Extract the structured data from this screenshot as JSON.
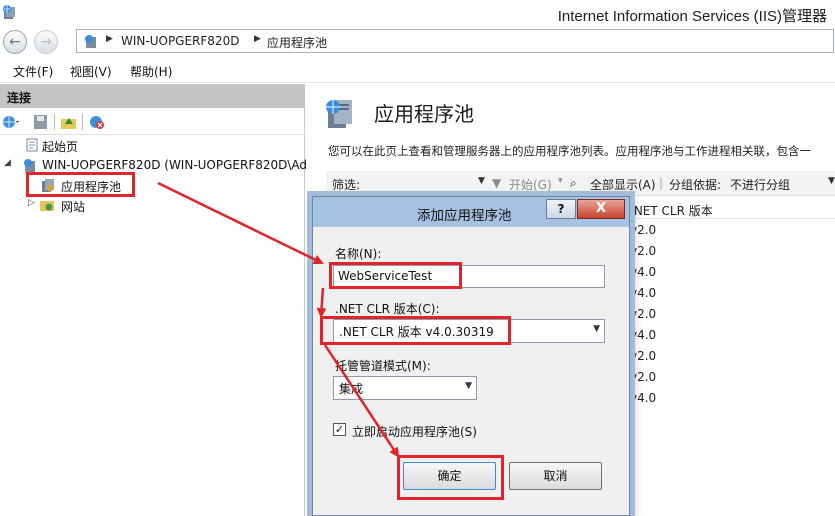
{
  "window": {
    "title": "Internet Information Services (IIS)管理器"
  },
  "address": {
    "segments": [
      "WIN-UOPGERF820D",
      "应用程序池"
    ]
  },
  "menu": {
    "items": [
      "文件(F)",
      "视图(V)",
      "帮助(H)"
    ]
  },
  "connections": {
    "header": "连接",
    "tree": {
      "start_page": "起始页",
      "server": "WIN-UOPGERF820D (WIN-UOPGERF820D\\Ad",
      "app_pools": "应用程序池",
      "sites": "网站"
    }
  },
  "main": {
    "title": "应用程序池",
    "description": "您可以在此页上查看和管理服务器上的应用程序池列表。应用程序池与工作进程相关联，包含一",
    "filter": {
      "label": "筛选:",
      "start": "开始(G)",
      "show_all": "全部显示(A)",
      "group_by_label": "分组依据:",
      "group_by_value": "不进行分组"
    },
    "list": {
      "column": ".NET CLR 版本",
      "values": [
        "v2.0",
        "v2.0",
        "v4.0",
        "v4.0",
        "v2.0",
        "v4.0",
        "v2.0",
        "v2.0",
        "v4.0"
      ]
    }
  },
  "dialog": {
    "title": "添加应用程序池",
    "help": "?",
    "close": "X",
    "name_label": "名称(N):",
    "name_value": "WebServiceTest",
    "clr_label": ".NET CLR 版本(C):",
    "clr_value": ".NET CLR 版本 v4.0.30319",
    "pipeline_label": "托管管道模式(M):",
    "pipeline_value": "集成",
    "start_immediately_label": "立即启动应用程序池(S)",
    "start_immediately_checked": "✓",
    "ok": "确定",
    "cancel": "取消"
  },
  "annotation_color": "#e0242a"
}
